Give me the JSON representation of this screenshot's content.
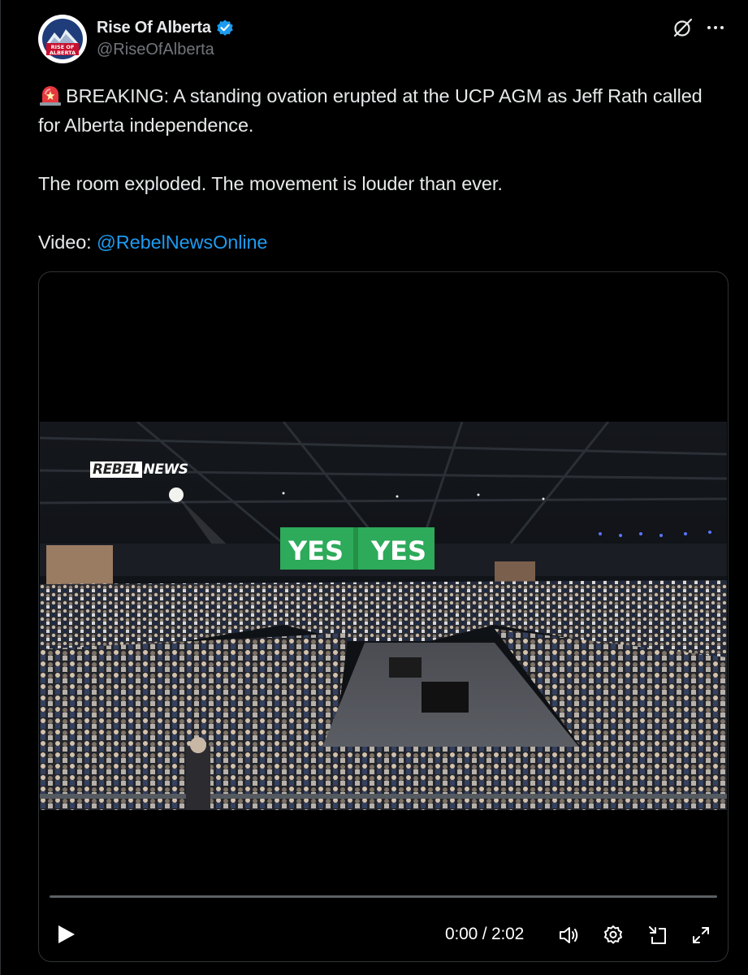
{
  "colors": {
    "background": "#000000",
    "text": "#e7e9ea",
    "secondary_text": "#71767b",
    "link": "#1d9bf0",
    "verified_badge": "#1d9bf0",
    "video_banner": "#2daa5a"
  },
  "author": {
    "display_name": "Rise Of Alberta",
    "handle": "@RiseOfAlberta",
    "verified": true,
    "avatar_text_line1": "RISE OF",
    "avatar_text_line2": "ALBERTA"
  },
  "header_icons": [
    "grok-icon",
    "more-icon"
  ],
  "tweet": {
    "line1_prefix_icon": "rotating-light-emoji",
    "paragraph1": "BREAKING: A standing ovation erupted at the UCP AGM as Jeff Rath called for Alberta independence.",
    "paragraph2": "The room exploded. The movement is louder than ever.",
    "video_credit_label": "Video: ",
    "video_credit_mention": "@RebelNewsOnline"
  },
  "video": {
    "watermark_part1": "REBEL",
    "watermark_part2": "NEWS",
    "banner_left": "YES",
    "banner_right": "YES",
    "current_time": "0:00",
    "duration": "2:02",
    "time_display": "0:00 / 2:02",
    "progress_fraction": 0,
    "controls": [
      "play-icon",
      "volume-icon",
      "settings-icon",
      "picture-in-picture-icon",
      "fullscreen-icon"
    ]
  }
}
